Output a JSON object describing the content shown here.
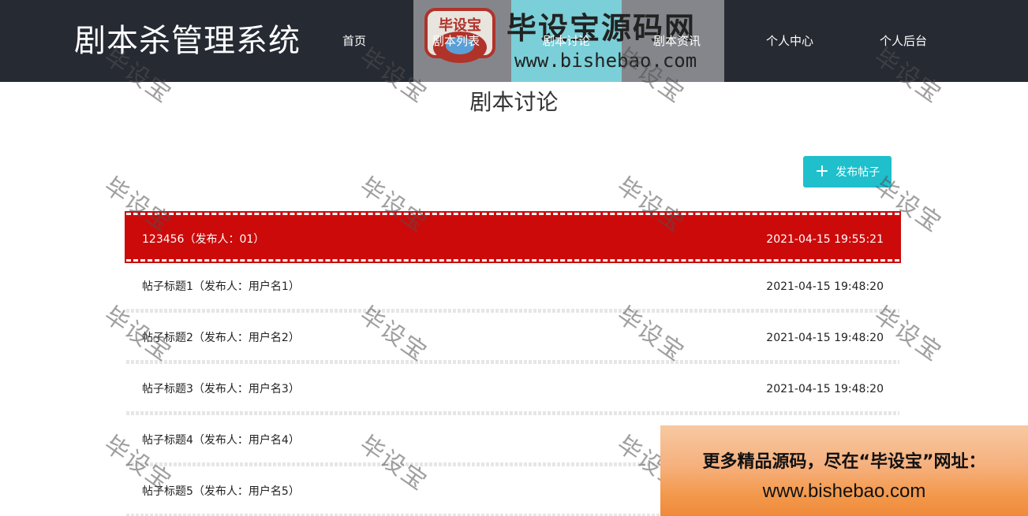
{
  "header": {
    "brand": "剧本杀管理系统",
    "nav": [
      "首页",
      "剧本列表",
      "剧本讨论",
      "剧本资讯",
      "个人中心",
      "个人后台"
    ]
  },
  "watermark_logo": {
    "badge_text": "毕设宝",
    "big_text": "毕设宝源码网",
    "url": "www.bishebao.com"
  },
  "page_title": "剧本讨论",
  "post_button": {
    "label": "发布帖子",
    "icon": "plus-icon"
  },
  "posts": [
    {
      "title": "123456（发布人：01）",
      "time": "2021-04-15 19:55:21",
      "active": true
    },
    {
      "title": "帖子标题1（发布人：用户名1）",
      "time": "2021-04-15 19:48:20"
    },
    {
      "title": "帖子标题2（发布人：用户名2）",
      "time": "2021-04-15 19:48:20"
    },
    {
      "title": "帖子标题3（发布人：用户名3）",
      "time": "2021-04-15 19:48:20"
    },
    {
      "title": "帖子标题4（发布人：用户名4）",
      "time": ""
    },
    {
      "title": "帖子标题5（发布人：用户名5）",
      "time": ""
    }
  ],
  "watermark_text": "毕设宝",
  "promo": {
    "line1": "更多精品源码，尽在“毕设宝”网址：",
    "line2": "www.bishebao.com"
  },
  "colors": {
    "header_bg": "#262a33",
    "active_row": "#cc0a0a",
    "button": "#1fbfcc"
  }
}
